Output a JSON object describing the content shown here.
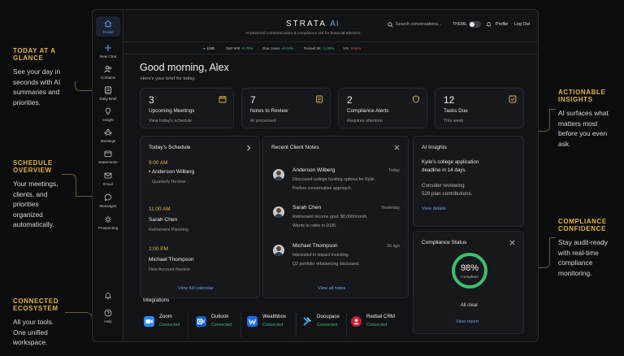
{
  "annotations": [
    {
      "title": "TODAY AT A GLANCE",
      "body": [
        "See your day in",
        "seconds with AI",
        "summaries and",
        "priorities."
      ]
    },
    {
      "title": "SCHEDULE",
      "title2": "OVERVIEW",
      "body": [
        "Your meetings,",
        "clients, and",
        "priorities",
        "organized",
        "automatically."
      ]
    },
    {
      "title": "CONNECTED",
      "title2": "ECOSYSTEM",
      "body": [
        "All your tools.",
        "One unified",
        "workspace."
      ]
    },
    {
      "title": "ACTIONABLE",
      "title2": "INSIGHTS",
      "body": [
        "AI surfaces what",
        "matters most",
        "before you even",
        "ask."
      ]
    },
    {
      "title": "COMPLIANCE",
      "title2": "CONFIDENCE",
      "body": [
        "Stay audit-ready",
        "with real-time",
        "compliance",
        "monitoring."
      ]
    }
  ],
  "sidebar": {
    "items": [
      {
        "label": "Home",
        "icon": "home-icon"
      },
      {
        "label": "New Chat",
        "icon": "plus-icon"
      },
      {
        "label": "Contacts",
        "icon": "contacts-icon"
      },
      {
        "label": "Daily Brief",
        "icon": "brief-icon"
      },
      {
        "label": "Insight",
        "icon": "lightbulb-icon"
      },
      {
        "label": "Meetings",
        "icon": "meetings-icon"
      },
      {
        "label": "Statements",
        "icon": "statements-icon"
      },
      {
        "label": "Email",
        "icon": "email-icon"
      },
      {
        "label": "Messages",
        "icon": "messages-icon"
      },
      {
        "label": "Prospecting",
        "icon": "prospecting-icon"
      }
    ],
    "bottom": [
      {
        "label": "",
        "icon": "bell-icon"
      },
      {
        "label": "Help",
        "icon": "help-icon"
      }
    ]
  },
  "header": {
    "brand": "STRATA",
    "brand_ai": "AI",
    "tagline": "AI-powered communication & compliance OS for financial advisors",
    "search_placeholder": "Search conversations...",
    "theme_label": "THEME",
    "profile": "Profile",
    "logout": "Log Out"
  },
  "ticker": {
    "live": "LIVE",
    "items": [
      {
        "name": "S&P 500",
        "change": "+0.78%",
        "dir": "up"
      },
      {
        "name": "Dow Jones",
        "change": "+0.04%",
        "dir": "up"
      },
      {
        "name": "Russell 2K",
        "change": "+1.08%",
        "dir": "up"
      },
      {
        "name": "VIX",
        "change": "-3.94%",
        "dir": "down"
      }
    ]
  },
  "greeting": {
    "title": "Good morning, Alex",
    "subtitle": "Here's your brief for today."
  },
  "stats": [
    {
      "value": "3",
      "title": "Upcoming Meetings",
      "sub": "View today's schedule",
      "icon": "calendar-icon"
    },
    {
      "value": "7",
      "title": "Notes to Review",
      "sub": "AI processed",
      "icon": "note-icon"
    },
    {
      "value": "2",
      "title": "Compliance Alerts",
      "sub": "Requires attention",
      "icon": "shield-icon"
    },
    {
      "value": "12",
      "title": "Tasks Due",
      "sub": "This week",
      "icon": "checkbox-icon"
    }
  ],
  "schedule": {
    "title": "Today's Schedule",
    "items": [
      {
        "time": "9:00 AM",
        "name": "Anderson Wilberg",
        "type": "Quarterly Review"
      },
      {
        "time": "11:00 AM",
        "name": "Sarah Chen",
        "type": "Retirement Planning"
      },
      {
        "time": "2:00 PM",
        "name": "Michael Thompson",
        "type": "New Account Review"
      }
    ],
    "link": "View full calendar"
  },
  "notes": {
    "title": "Recent Client Notes",
    "items": [
      {
        "name": "Anderson Wilberg",
        "date": "Today",
        "line1": "Discussed college funding options for Kylie.",
        "line2": "Prefers conservative approach."
      },
      {
        "name": "Sarah Chen",
        "date": "Yesterday",
        "line1": "Retirement income goal: $8,000/month.",
        "line2": "Wants to retire in 2030."
      },
      {
        "name": "Michael Thompson",
        "date": "2d ago",
        "line1": "Interested in impact investing.",
        "line2": "Q2 portfolio rebalancing discussed."
      }
    ],
    "link": "View all notes"
  },
  "ai_insights": {
    "title": "AI Insights",
    "line1": "Kylie's college application",
    "line2": "deadline in 14 days.",
    "line3": "Consider reviewing",
    "line4": "529 plan contributions.",
    "link": "View details"
  },
  "compliance": {
    "title": "Compliance Status",
    "percent_label": "98%",
    "percent": 98,
    "ring_label": "Compliant",
    "status": "All clear",
    "link": "View report"
  },
  "integrations": {
    "title": "Integrations",
    "items": [
      {
        "name": "Zoom",
        "status": "Connected",
        "color": "#2d8cff"
      },
      {
        "name": "Outlook",
        "status": "Connected",
        "color": "#0a64c8"
      },
      {
        "name": "Wealthbox",
        "status": "Connected",
        "color": "#1f6feb"
      },
      {
        "name": "Docupace",
        "status": "Connected",
        "color": "#19a7e0"
      },
      {
        "name": "Redtail CRM",
        "status": "Connected",
        "color": "#c8202a"
      }
    ]
  },
  "colors": {
    "accent": "#e3b341",
    "link": "#6ea0e8",
    "positive": "#3fbf6f",
    "negative": "#e0524e"
  }
}
